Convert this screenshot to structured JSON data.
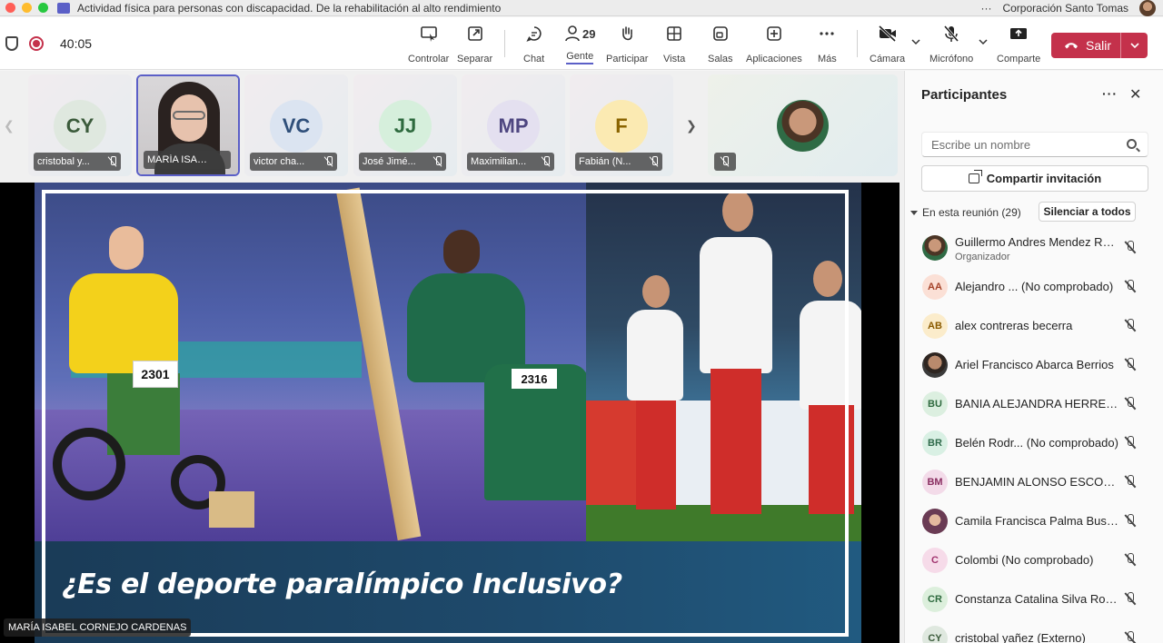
{
  "window": {
    "title": "Actividad física para personas con discapacidad. De la rehabilitación al alto rendimiento",
    "more": "···",
    "org": "Corporación Santo Tomas"
  },
  "toolbar": {
    "timer": "40:05",
    "buttons": [
      {
        "label": "Controlar",
        "icon": "control-icon"
      },
      {
        "label": "Separar",
        "icon": "pop-out-icon"
      },
      {
        "label": "Chat",
        "icon": "chat-icon"
      },
      {
        "label": "Gente",
        "icon": "people-icon",
        "count": "29",
        "active": true
      },
      {
        "label": "Participar",
        "icon": "raise-hand-icon"
      },
      {
        "label": "Vista",
        "icon": "view-icon"
      },
      {
        "label": "Salas",
        "icon": "rooms-icon"
      },
      {
        "label": "Aplicaciones",
        "icon": "apps-icon"
      },
      {
        "label": "Más",
        "icon": "more-icon"
      },
      {
        "label": "Cámara",
        "icon": "camera-off-icon"
      },
      {
        "label": "Micrófono",
        "icon": "mic-off-icon"
      },
      {
        "label": "Comparte",
        "icon": "share-screen-icon"
      }
    ],
    "leave_label": "Salir",
    "leave_color": "#c4314b",
    "accent_color": "#5b5fc7"
  },
  "thumbnails": [
    {
      "initials": "CY",
      "name": "cristobal y...",
      "bg": "#dfe8df",
      "fg": "#3b5b3b"
    },
    {
      "initials": "",
      "name": "MARÍA ISABEL...",
      "speaking": true
    },
    {
      "initials": "VC",
      "name": "victor cha...",
      "bg": "#dbe4f1",
      "fg": "#2f4f7a"
    },
    {
      "initials": "JJ",
      "name": "José Jimé...",
      "bg": "#d6efdc",
      "fg": "#2e6a3e"
    },
    {
      "initials": "MP",
      "name": "Maximilian...",
      "bg": "#e4e0f0",
      "fg": "#4e4680"
    },
    {
      "initials": "F",
      "name": "Fabián (N...",
      "bg": "#fbeab2",
      "fg": "#8a6400"
    }
  ],
  "slide": {
    "caption": "¿Es el deporte paralímpico Inclusivo?",
    "bib1": "2301",
    "bib2": "2316",
    "presenter": "MARÍA ISABEL CORNEJO CARDENAS"
  },
  "panel": {
    "title": "Participantes",
    "search_placeholder": "Escribe un nombre",
    "share_invite": "Compartir invitación",
    "section_label": "En esta reunión (29)",
    "mute_all": "Silenciar a todos",
    "participants": [
      {
        "initials": "",
        "name": "Guillermo Andres Mendez Re...",
        "role": "Organizador",
        "photo": "ph-guillermo"
      },
      {
        "initials": "AA",
        "name": "Alejandro ...  (No comprobado)",
        "bg": "#fbe0d6",
        "fg": "#a5432a"
      },
      {
        "initials": "AB",
        "name": "alex contreras becerra",
        "bg": "#fbeccb",
        "fg": "#8a5a00"
      },
      {
        "initials": "",
        "name": "Ariel Francisco Abarca Berrios",
        "photo": "ph-ariel"
      },
      {
        "initials": "BU",
        "name": "BANIA ALEJANDRA HERRER...",
        "bg": "#dcefe0",
        "fg": "#2e6a3e"
      },
      {
        "initials": "BR",
        "name": "Belén Rodr... (No comprobado)",
        "bg": "#d9f0e4",
        "fg": "#2e6a4a"
      },
      {
        "initials": "BM",
        "name": "BENJAMIN ALONSO ESCOB...",
        "bg": "#f3dbe9",
        "fg": "#8a2f62"
      },
      {
        "initials": "",
        "name": "Camila Francisca Palma Bust...",
        "photo": "ph-camila"
      },
      {
        "initials": "C",
        "name": "Colombi (No comprobado)",
        "bg": "#f6dbe9",
        "fg": "#a0336e"
      },
      {
        "initials": "CR",
        "name": "Constanza Catalina Silva Rojas",
        "bg": "#dcefdc",
        "fg": "#2e6a3e"
      },
      {
        "initials": "CY",
        "name": "cristobal yañez (Externo)",
        "bg": "#dfe8df",
        "fg": "#3b5b3b"
      }
    ]
  }
}
